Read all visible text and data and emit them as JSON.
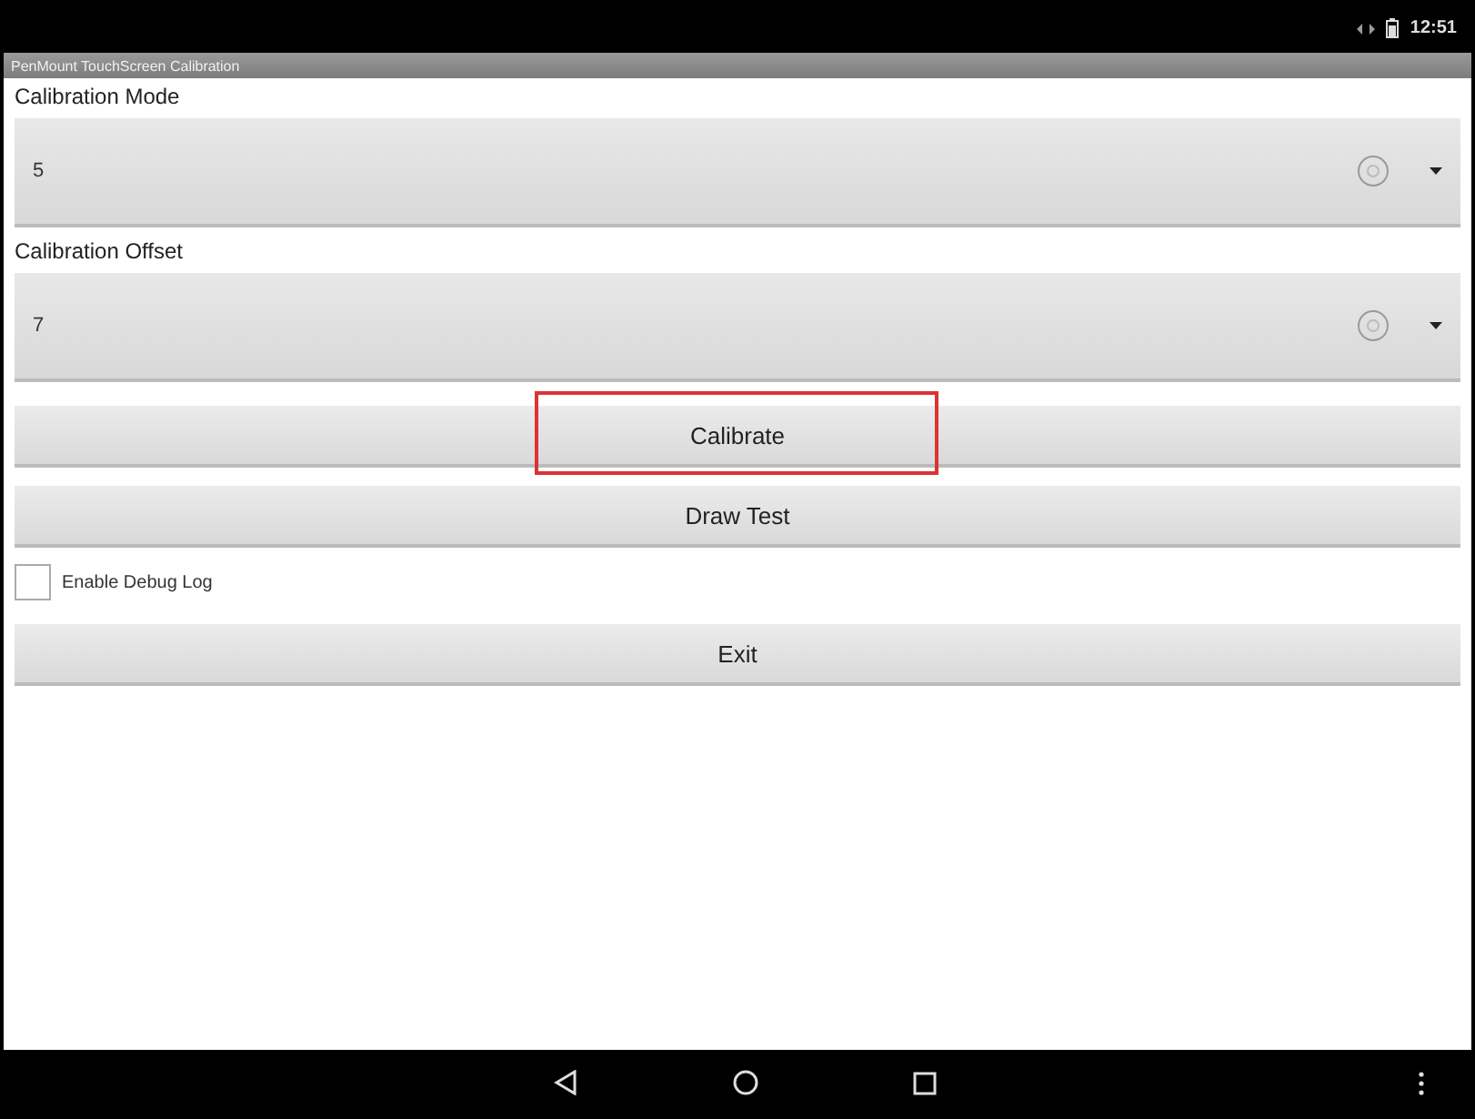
{
  "status_bar": {
    "time": "12:51"
  },
  "title_bar": {
    "title": "PenMount TouchScreen Calibration"
  },
  "settings": [
    {
      "label": "Calibration Mode",
      "value": "5"
    },
    {
      "label": "Calibration Offset",
      "value": "7"
    }
  ],
  "buttons": [
    {
      "kind": "button",
      "label": "Calibrate",
      "highlighted": true
    },
    {
      "kind": "button",
      "label": "Draw Test",
      "highlighted": false
    },
    {
      "kind": "checkbox",
      "label": "Enable Debug Log",
      "checked": false
    },
    {
      "kind": "button",
      "label": "Exit",
      "highlighted": false
    }
  ]
}
